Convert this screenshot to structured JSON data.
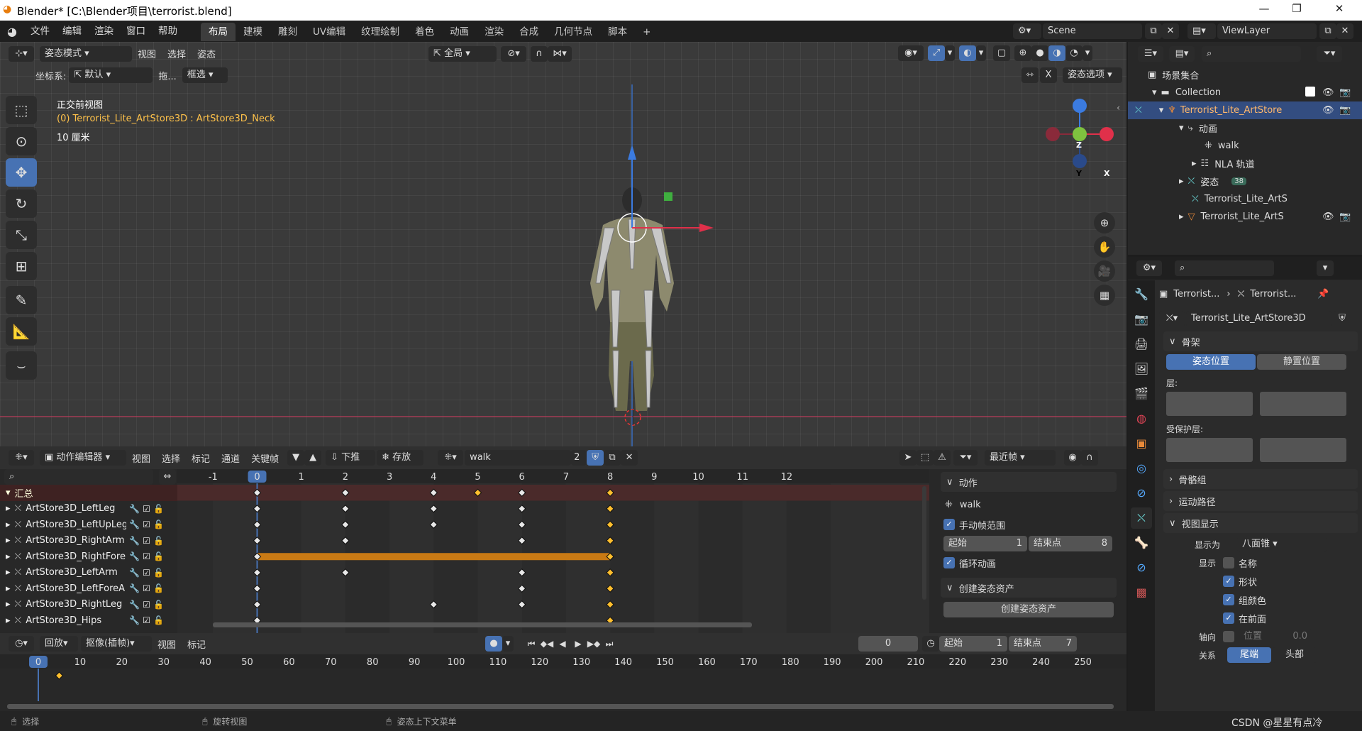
{
  "window": {
    "title": "Blender* [C:\\Blender项目\\terrorist.blend]",
    "minimize": "—",
    "maximize": "❐",
    "close": "✕"
  },
  "menu": {
    "items": [
      "文件",
      "编辑",
      "渲染",
      "窗口",
      "帮助"
    ],
    "workspaces": [
      "布局",
      "建模",
      "雕刻",
      "UV编辑",
      "纹理绘制",
      "着色",
      "动画",
      "渲染",
      "合成",
      "几何节点",
      "脚本"
    ],
    "add_tab": "+",
    "scene": "Scene",
    "view_layer": "ViewLayer"
  },
  "viewport": {
    "mode": "姿态模式",
    "menu_view": "视图",
    "menu_select": "选择",
    "menu_pose": "姿态",
    "orientation": "全局",
    "coord_label": "坐标系:",
    "coord_value": "默认",
    "drag_label": "拖...",
    "drag_value": "框选",
    "pose_options": "姿态选项",
    "x_label": "X",
    "overlay_view": "正交前视图",
    "overlay_object": "(0) Terrorist_Lite_ArtStore3D : ArtStore3D_Neck",
    "overlay_scale": "10 厘米",
    "gizmo": {
      "z": "Z",
      "y": "Y",
      "x": "X"
    }
  },
  "outliner": {
    "title": "场景集合",
    "rows": [
      {
        "label": "Collection"
      },
      {
        "label": "Terrorist_Lite_ArtStore"
      },
      {
        "label": "动画"
      },
      {
        "label": "walk"
      },
      {
        "label": "NLA 轨道"
      },
      {
        "label": "姿态"
      },
      {
        "label": "Terrorist_Lite_ArtS"
      },
      {
        "label": "Terrorist_Lite_ArtS"
      }
    ],
    "pose_count": "38"
  },
  "properties": {
    "breadcrumb1": "Terrorist...",
    "breadcrumb2": "Terrorist...",
    "armature_name": "Terrorist_Lite_ArtStore3D",
    "skeleton": "骨架",
    "pose_position": "姿态位置",
    "rest_position": "静置位置",
    "layers": "层:",
    "protected_layers": "受保护层:",
    "bone_groups": "骨骼组",
    "motion_paths": "运动路径",
    "viewport_display": "视图显示",
    "display_as_label": "显示为",
    "display_as": "八面锥",
    "show_label": "显示",
    "show_name": "名称",
    "show_shape": "形状",
    "show_group_color": "组颜色",
    "show_in_front": "在前面",
    "axes_label": "轴向",
    "axes_position": "位置",
    "axes_value": "0.0",
    "relation_label": "关系",
    "relation_tail": "尾端",
    "relation_head": "头部"
  },
  "dopesheet": {
    "editor": "动作编辑器",
    "view": "视图",
    "select": "选择",
    "marker": "标记",
    "channel": "通道",
    "key": "关键帧",
    "push_down": "下推",
    "stash": "存放",
    "action": "walk",
    "users": "2",
    "snapping": "最近帧",
    "frame_labels": [
      "-1",
      "0",
      "1",
      "2",
      "3",
      "4",
      "5",
      "6",
      "7",
      "8",
      "9",
      "10",
      "11",
      "12"
    ],
    "frame_values": [
      -1,
      0,
      1,
      2,
      3,
      4,
      5,
      6,
      7,
      8,
      9,
      10,
      11,
      12
    ],
    "channels": [
      "汇总",
      "ArtStore3D_LeftLeg",
      "ArtStore3D_LeftUpLeg",
      "ArtStore3D_RightArm",
      "ArtStore3D_RightFore",
      "ArtStore3D_LeftArm",
      "ArtStore3D_LeftForeA",
      "ArtStore3D_RightLeg",
      "ArtStore3D_Hips"
    ],
    "keys": [
      [
        0,
        2,
        4,
        5,
        6,
        8
      ],
      [
        0,
        2,
        4,
        6,
        8
      ],
      [
        0,
        2,
        4,
        6,
        8
      ],
      [
        0,
        2,
        6,
        8
      ],
      [
        0,
        8
      ],
      [
        0,
        2,
        6,
        8
      ],
      [
        0,
        6,
        8
      ],
      [
        0,
        4,
        6,
        8
      ],
      [
        0,
        8
      ]
    ],
    "hold_row": 4,
    "hold_from": 0,
    "hold_to": 8,
    "current_frame": 0
  },
  "action_panel": {
    "header": "动作",
    "action": "walk",
    "manual_range": "手动帧范围",
    "start_label": "起始",
    "start": "1",
    "end_label": "结束点",
    "end": "8",
    "cyclic": "循环动画",
    "create_pose_asset_header": "创建姿态资产",
    "create_pose_asset_button": "创建姿态资产"
  },
  "timeline": {
    "playback": "回放",
    "keying": "抠像(插帧)",
    "view": "视图",
    "marker": "标记",
    "current": "0",
    "start_label": "起始",
    "start": "1",
    "end_label": "结束点",
    "end": "7",
    "ticks": [
      0,
      10,
      20,
      30,
      40,
      50,
      60,
      70,
      80,
      90,
      100,
      110,
      120,
      130,
      140,
      150,
      160,
      170,
      180,
      190,
      200,
      210,
      220,
      230,
      240,
      250
    ],
    "key_frame": 5
  },
  "status": {
    "select": "选择",
    "rotate": "旋转视图",
    "context": "姿态上下文菜单",
    "watermark": "CSDN @星星有点冷"
  }
}
